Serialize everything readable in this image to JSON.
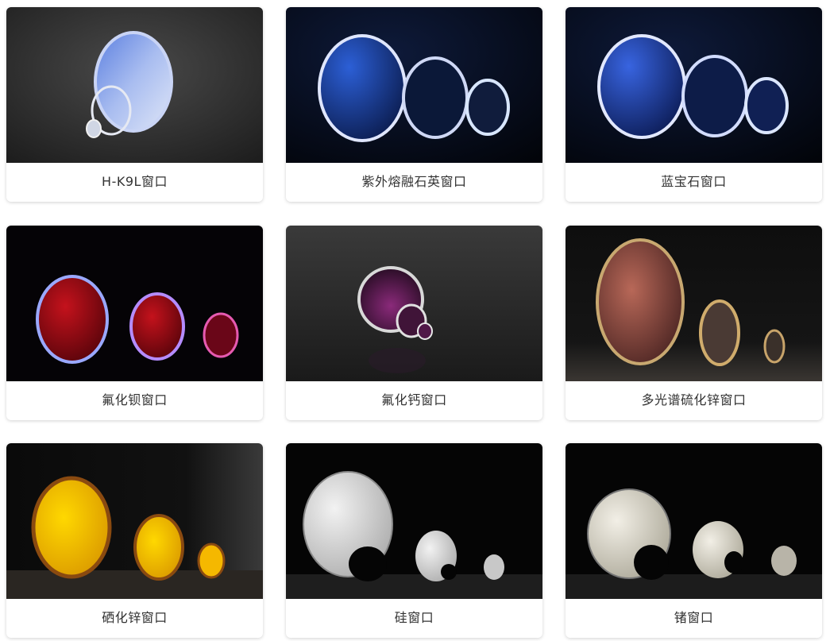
{
  "products": [
    {
      "label": "H-K9L窗口",
      "icon": "k9l-window-image"
    },
    {
      "label": "紫外熔融石英窗口",
      "icon": "uv-fused-silica-window-image"
    },
    {
      "label": "蓝宝石窗口",
      "icon": "sapphire-window-image"
    },
    {
      "label": "氟化钡窗口",
      "icon": "barium-fluoride-window-image"
    },
    {
      "label": "氟化钙窗口",
      "icon": "calcium-fluoride-window-image"
    },
    {
      "label": "多光谱硫化锌窗口",
      "icon": "multispectral-zns-window-image"
    },
    {
      "label": "硒化锌窗口",
      "icon": "znse-window-image"
    },
    {
      "label": "硅窗口",
      "icon": "silicon-window-image"
    },
    {
      "label": "锗窗口",
      "icon": "germanium-window-image"
    }
  ],
  "colors": {
    "caption_text": "#333333",
    "card_bg": "#ffffff"
  }
}
